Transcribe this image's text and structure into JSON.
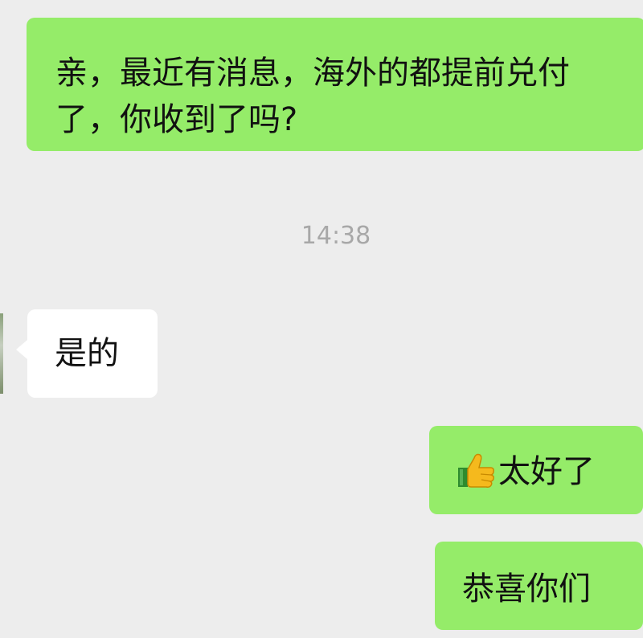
{
  "chat": {
    "messages": [
      {
        "text": "亲，最近有消息，海外的都提前兑付了，你收到了吗?"
      },
      {
        "text": "是的"
      },
      {
        "text": "太好了",
        "icon": "thumbs-up-icon"
      },
      {
        "text": "恭喜你们"
      }
    ],
    "timestamp": "14:38"
  },
  "colors": {
    "background": "#ededed",
    "sent_bubble": "#95ec69",
    "received_bubble": "#ffffff",
    "timestamp_text": "#a8a8a8",
    "message_text": "#111111"
  }
}
